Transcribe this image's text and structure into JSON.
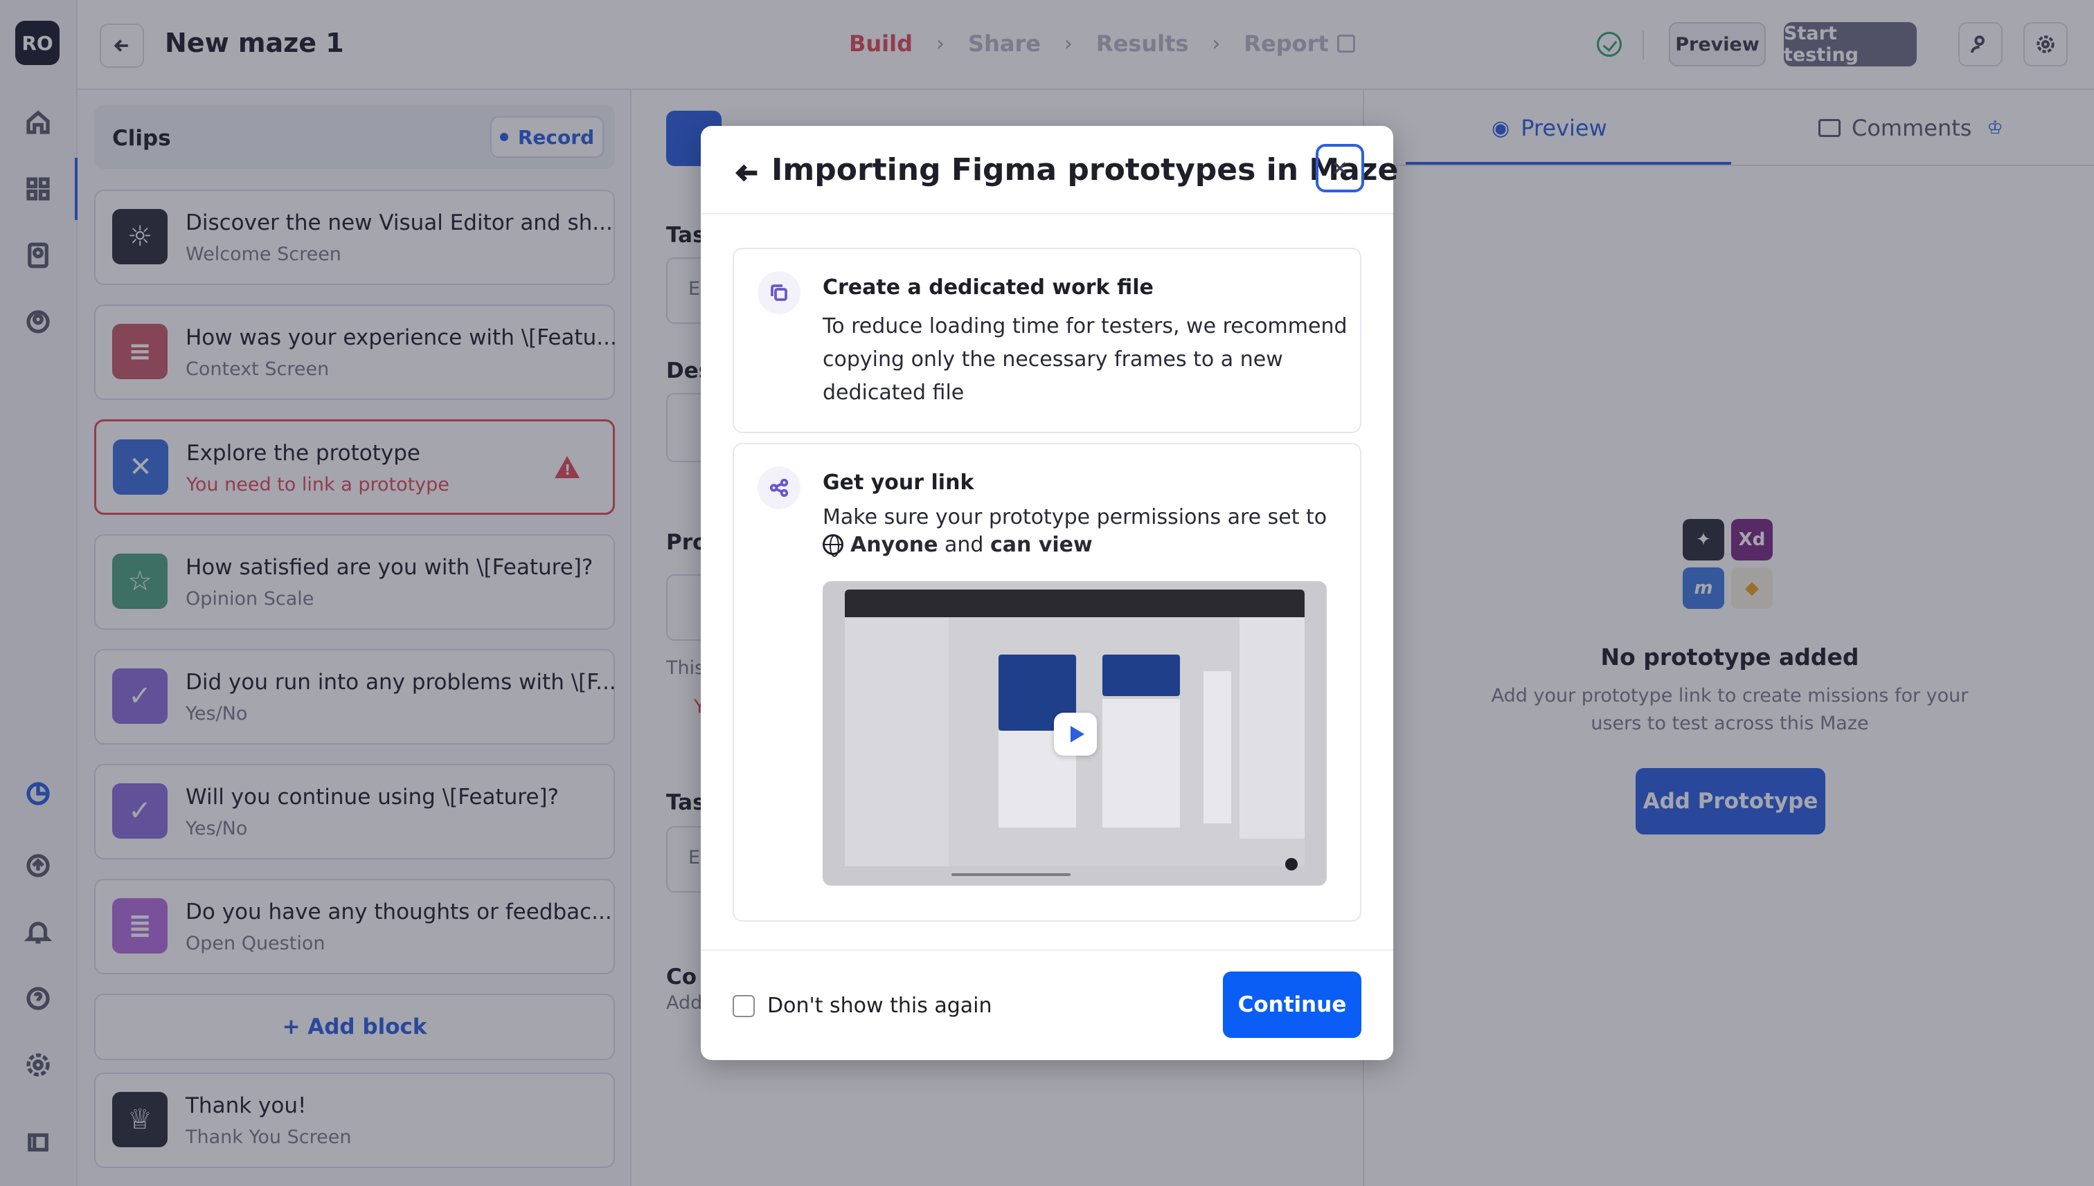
{
  "rail": {
    "avatar": "RO"
  },
  "header": {
    "maze_title": "New maze 1",
    "steps": [
      "Build",
      "Share",
      "Results",
      "Report"
    ],
    "preview_label": "Preview",
    "start_label": "Start testing"
  },
  "clips": {
    "title": "Clips",
    "record_label": "Record",
    "blocks": [
      {
        "title": "Discover the new Visual Editor and sh...",
        "subtitle": "Welcome Screen",
        "color": "#2d2d3a",
        "icon": "sun-icon"
      },
      {
        "title": "How was your experience with \\[Featu...",
        "subtitle": "Context Screen",
        "color": "#c95a6a",
        "icon": "context-icon"
      },
      {
        "title": "Explore the prototype",
        "subtitle": "You need to link a prototype",
        "color": "#3d6fdc",
        "icon": "prototype-icon"
      },
      {
        "title": "How satisfied are you with \\[Feature]?",
        "subtitle": "Opinion Scale",
        "color": "#4fa280",
        "icon": "star-icon"
      },
      {
        "title": "Did you run into any problems with \\[F...",
        "subtitle": "Yes/No",
        "color": "#8a6fdc",
        "icon": "yes-no-icon"
      },
      {
        "title": "Will you continue using \\[Feature]?",
        "subtitle": "Yes/No",
        "color": "#8a6fdc",
        "icon": "yes-no-icon"
      },
      {
        "title": "Do you have any thoughts or feedbac...",
        "subtitle": "Open Question",
        "color": "#b56ee0",
        "icon": "open-question-icon"
      }
    ],
    "add_block_label": "+ Add block",
    "thank_you": {
      "title": "Thank you!",
      "subtitle": "Thank You Screen",
      "color": "#2d2d3a",
      "icon": "trophy-icon"
    }
  },
  "editor": {
    "labels": [
      "Tas",
      "Des",
      "Pro",
      "Tas",
      "Co"
    ],
    "fragments": [
      "E",
      "This",
      "Y",
      "E",
      "Add"
    ]
  },
  "right_panel": {
    "tabs": [
      "Preview",
      "Comments"
    ],
    "logo_text_xd": "Xd",
    "logo_text_m": "m",
    "empty_title": "No prototype added",
    "empty_sub": "Add your prototype link to create missions for your users to test across this Maze",
    "add_prototype_label": "Add Prototype"
  },
  "modal": {
    "title": "Importing Figma prototypes in Maze",
    "card1": {
      "title": "Create a dedicated work file",
      "body": "To reduce loading time for testers, we recommend copying only the necessary frames to a new dedicated file"
    },
    "card2": {
      "title": "Get your link",
      "body_prefix": "Make sure your prototype permissions are set to",
      "anyone": "Anyone",
      "and": "and",
      "can_view": "can view"
    },
    "checkbox_label": "Don't show this again",
    "continue_label": "Continue"
  }
}
